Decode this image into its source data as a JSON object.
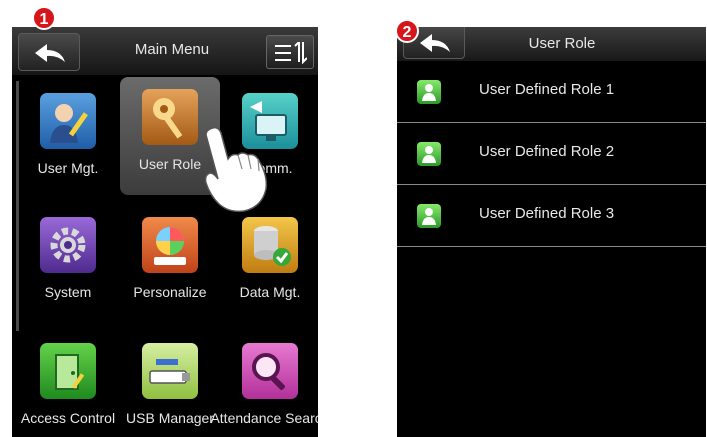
{
  "steps": {
    "one": "1",
    "two": "2"
  },
  "main_menu": {
    "title": "Main Menu",
    "items": [
      {
        "label": "User Mgt.",
        "icon": "user-management-icon"
      },
      {
        "label": "User Role",
        "icon": "key-icon"
      },
      {
        "label": "Comm.",
        "icon": "network-computer-icon"
      },
      {
        "label": "System",
        "icon": "gear-icon"
      },
      {
        "label": "Personalize",
        "icon": "color-wheel-icon"
      },
      {
        "label": "Data Mgt.",
        "icon": "database-icon"
      },
      {
        "label": "Access Control",
        "icon": "door-icon"
      },
      {
        "label": "USB Manager",
        "icon": "usb-drive-icon"
      },
      {
        "label": "Attendance Search",
        "icon": "magnifier-icon"
      }
    ],
    "selected": "User Role"
  },
  "user_role": {
    "title": "User Role",
    "items": [
      {
        "label": "User Defined Role 1"
      },
      {
        "label": "User Defined Role 2"
      },
      {
        "label": "User Defined Role 3"
      }
    ]
  },
  "colors": {
    "badge": "#d6161b",
    "screen_bg": "#000000",
    "role_icon": "#3fb83a"
  }
}
